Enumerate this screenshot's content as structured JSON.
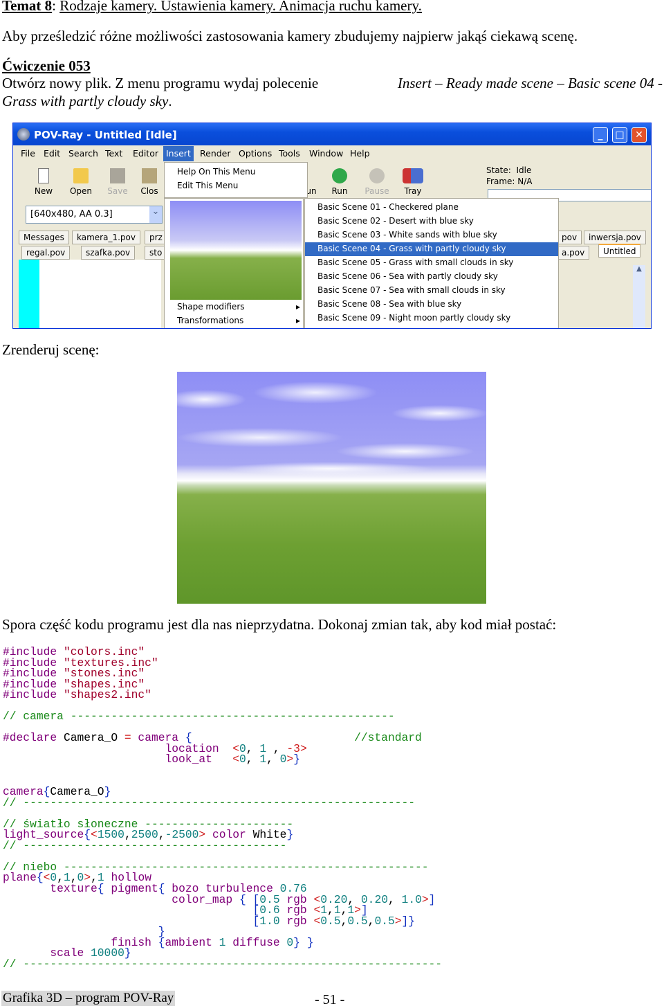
{
  "topic": {
    "label": "Temat 8",
    "rest": "Rodzaje kamery. Ustawienia kamery. Animacja ruchu kamery."
  },
  "intro": "Aby prześledzić różne możliwości zastosowania kamery zbudujemy najpierw jakąś ciekawą scenę.",
  "exercise": {
    "title": "Ćwiczenie 053",
    "line1_pre": "Otwórz nowy plik. Z menu programu wydaj polecenie ",
    "line1_cmd": "Insert – Ready made scene – Basic scene 04 -",
    "line2_cmd": "Grass with partly cloudy sky",
    "line2_post": "."
  },
  "window": {
    "title": "POV-Ray - Untitled [Idle]",
    "menu": [
      "File",
      "Edit",
      "Search",
      "Text",
      "Editor",
      "Insert",
      "Render",
      "Options",
      "Tools",
      "Window",
      "Help"
    ],
    "active_menu": "Insert",
    "toolbar": {
      "new": "New",
      "open": "Open",
      "save": "Save",
      "close": "Clos",
      "run_partial": "un",
      "run": "Run",
      "pause": "Pause",
      "tray": "Tray"
    },
    "status": {
      "state_label": "State:",
      "state": "Idle",
      "frame_label": "Frame:",
      "frame": "N/A"
    },
    "resolution": "[640x480, AA 0.3]",
    "tabs_row1": [
      "Messages",
      "kamera_1.pov",
      "prz",
      "pov",
      "inwersja.pov"
    ],
    "tabs_row2": [
      "regal.pov",
      "szafka.pov",
      "sto",
      "a.pov",
      "Untitled"
    ],
    "insert_menu": {
      "items": [
        "Help On This Menu",
        "Edit This Menu"
      ],
      "submenus": [
        "Shape modifiers",
        "Transformations"
      ]
    },
    "scene_menu": [
      "Basic Scene 01 - Checkered plane",
      "Basic Scene 02 - Desert with blue sky",
      "Basic Scene 03 - White sands with blue sky",
      "Basic Scene 04 - Grass with partly cloudy sky",
      "Basic Scene 05 - Grass with small clouds in sky",
      "Basic Scene 06 - Sea with partly cloudy sky",
      "Basic Scene 07 - Sea with small clouds in sky",
      "Basic Scene 08 - Sea with blue sky",
      "Basic Scene 09 - Night moon partly cloudy sky"
    ],
    "selected_scene": 3,
    "colors": {
      "titlebar": "#0a4fdc",
      "selection": "#316ac5",
      "chrome": "#ece9d8"
    }
  },
  "render_label": "Zrenderuj scenę:",
  "code_intro": "Spora część kodu programu jest dla nas nieprzydatna. Dokonaj zmian tak, aby kod miał postać:",
  "code": [
    [
      [
        "#include ",
        "k"
      ],
      [
        "\"colors.inc\"",
        "s"
      ]
    ],
    [
      [
        "#include ",
        "k"
      ],
      [
        "\"textures.inc\"",
        "s"
      ]
    ],
    [
      [
        "#include ",
        "k"
      ],
      [
        "\"stones.inc\"",
        "s"
      ]
    ],
    [
      [
        "#include ",
        "k"
      ],
      [
        "\"shapes.inc\"",
        "s"
      ]
    ],
    [
      [
        "#include ",
        "k"
      ],
      [
        "\"shapes2.inc\"",
        "s"
      ]
    ],
    [],
    [
      [
        "// camera ------------------------------------------------",
        "c"
      ]
    ],
    [],
    [
      [
        "#declare ",
        "k"
      ],
      [
        "Camera_O ",
        "x"
      ],
      [
        "= ",
        "p"
      ],
      [
        "camera ",
        "k"
      ],
      [
        "{",
        "b"
      ],
      [
        "                        //standard",
        "c"
      ]
    ],
    [
      [
        "                        location  ",
        "k"
      ],
      [
        "<",
        "p"
      ],
      [
        "0",
        "n"
      ],
      [
        ", ",
        "x"
      ],
      [
        "1",
        "n"
      ],
      [
        " , ",
        "x"
      ],
      [
        "-3>",
        "p"
      ]
    ],
    [
      [
        "                        look_at   ",
        "k"
      ],
      [
        "<",
        "p"
      ],
      [
        "0",
        "n"
      ],
      [
        ", ",
        "x"
      ],
      [
        "1",
        "n"
      ],
      [
        ", ",
        "x"
      ],
      [
        "0",
        "n"
      ],
      [
        ">",
        "p"
      ],
      [
        "}",
        "b"
      ]
    ],
    [],
    [],
    [
      [
        "camera",
        "k"
      ],
      [
        "{",
        "b"
      ],
      [
        "Camera_O",
        "x"
      ],
      [
        "}",
        "b"
      ]
    ],
    [
      [
        "// ----------------------------------------------------------",
        "c"
      ]
    ],
    [],
    [
      [
        "// światło słoneczne ----------------------",
        "c"
      ]
    ],
    [
      [
        "light_source",
        "k"
      ],
      [
        "{",
        "b"
      ],
      [
        "<",
        "p"
      ],
      [
        "1500",
        "n"
      ],
      [
        ",",
        "x"
      ],
      [
        "2500",
        "n"
      ],
      [
        ",",
        "x"
      ],
      [
        "-2500",
        "n"
      ],
      [
        "> ",
        "p"
      ],
      [
        "color ",
        "k"
      ],
      [
        "White",
        "x"
      ],
      [
        "}",
        "b"
      ]
    ],
    [
      [
        "// ---------------------------------------",
        "c"
      ]
    ],
    [],
    [
      [
        "// niebo ------------------------------------------------------",
        "c"
      ]
    ],
    [
      [
        "plane",
        "k"
      ],
      [
        "{",
        "b"
      ],
      [
        "<",
        "p"
      ],
      [
        "0",
        "n"
      ],
      [
        ",",
        "x"
      ],
      [
        "1",
        "n"
      ],
      [
        ",",
        "x"
      ],
      [
        "0",
        "n"
      ],
      [
        ">",
        "p"
      ],
      [
        ",",
        "x"
      ],
      [
        "1 ",
        "n"
      ],
      [
        "hollow",
        "k"
      ]
    ],
    [
      [
        "       texture",
        "k"
      ],
      [
        "{ ",
        "b"
      ],
      [
        "pigment",
        "k"
      ],
      [
        "{ ",
        "b"
      ],
      [
        "bozo turbulence ",
        "k"
      ],
      [
        "0.76",
        "n"
      ]
    ],
    [
      [
        "                         color_map ",
        "k"
      ],
      [
        "{ ",
        "b"
      ],
      [
        "[",
        "b"
      ],
      [
        "0.5 ",
        "n"
      ],
      [
        "rgb ",
        "k"
      ],
      [
        "<",
        "p"
      ],
      [
        "0.20",
        "n"
      ],
      [
        ", ",
        "x"
      ],
      [
        "0.20",
        "n"
      ],
      [
        ", ",
        "x"
      ],
      [
        "1.0",
        "n"
      ],
      [
        ">",
        "p"
      ],
      [
        "]",
        "b"
      ]
    ],
    [
      [
        "                                     [",
        "b"
      ],
      [
        "0.6 ",
        "n"
      ],
      [
        "rgb ",
        "k"
      ],
      [
        "<",
        "p"
      ],
      [
        "1",
        "n"
      ],
      [
        ",",
        "x"
      ],
      [
        "1",
        "n"
      ],
      [
        ",",
        "x"
      ],
      [
        "1",
        "n"
      ],
      [
        ">",
        "p"
      ],
      [
        "]",
        "b"
      ]
    ],
    [
      [
        "                                     [",
        "b"
      ],
      [
        "1.0 ",
        "n"
      ],
      [
        "rgb ",
        "k"
      ],
      [
        "<",
        "p"
      ],
      [
        "0.5",
        "n"
      ],
      [
        ",",
        "x"
      ],
      [
        "0.5",
        "n"
      ],
      [
        ",",
        "x"
      ],
      [
        "0.5",
        "n"
      ],
      [
        ">",
        "p"
      ],
      [
        "]}",
        "b"
      ]
    ],
    [
      [
        "                       }",
        "b"
      ]
    ],
    [
      [
        "                finish ",
        "k"
      ],
      [
        "{",
        "b"
      ],
      [
        "ambient ",
        "k"
      ],
      [
        "1 ",
        "n"
      ],
      [
        "diffuse ",
        "k"
      ],
      [
        "0",
        "n"
      ],
      [
        "} }",
        "b"
      ]
    ],
    [
      [
        "       scale ",
        "k"
      ],
      [
        "10000",
        "n"
      ],
      [
        "}",
        "b"
      ]
    ],
    [
      [
        "// --------------------------------------------------------------",
        "c"
      ]
    ]
  ],
  "footer": {
    "title": "Grafika 3D – program POV-Ray",
    "page": "- 51 -"
  }
}
